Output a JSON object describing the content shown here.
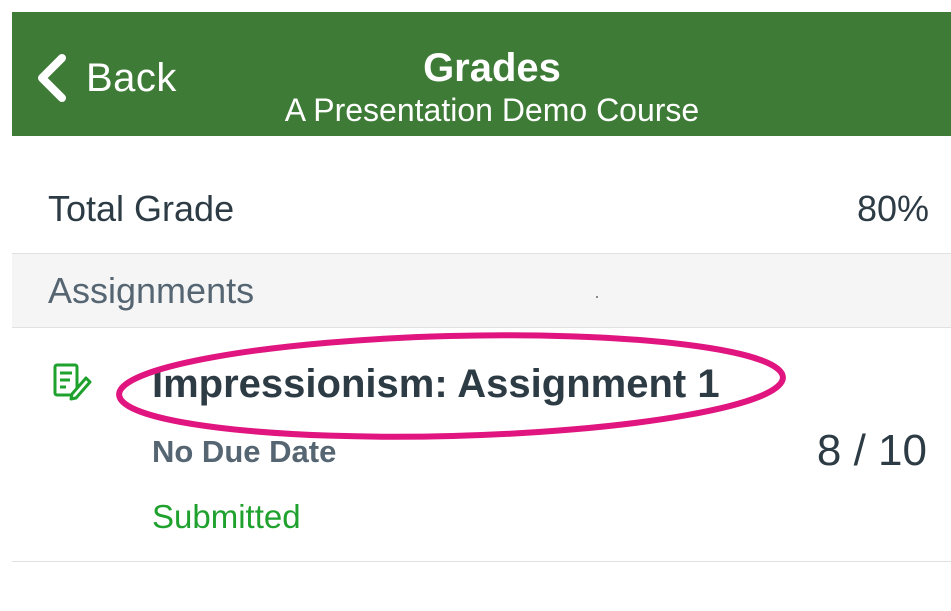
{
  "navbar": {
    "back_label": "Back",
    "title": "Grades",
    "subtitle": "A Presentation Demo Course",
    "color": "#3e7b36"
  },
  "total": {
    "label": "Total Grade",
    "value": "80%"
  },
  "section": {
    "label": "Assignments"
  },
  "assignments": [
    {
      "icon": "assignment-edit-icon",
      "title": "Impressionism: Assignment 1",
      "due": "No Due Date",
      "status": "Submitted",
      "score": "8 / 10",
      "status_color": "#1fa12d"
    }
  ],
  "annotation": {
    "type": "ellipse-highlight",
    "color": "#e0157f"
  }
}
